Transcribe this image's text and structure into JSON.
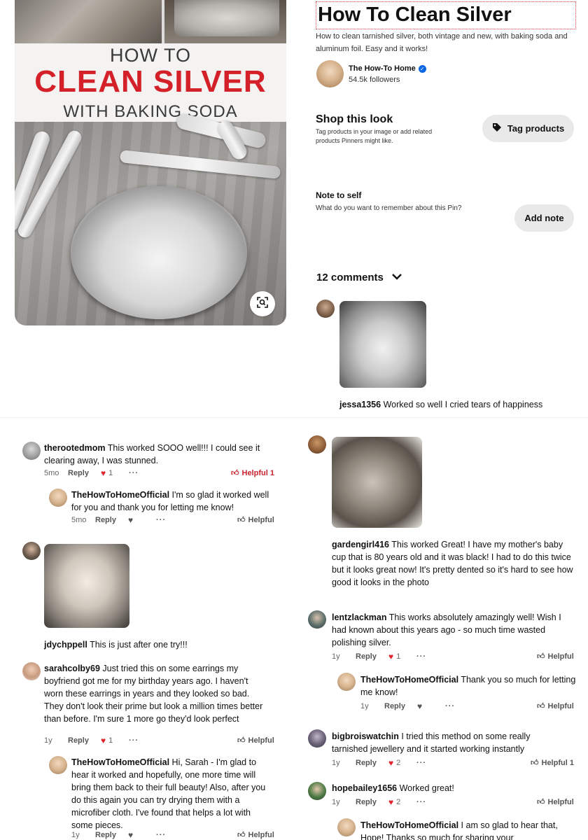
{
  "pin": {
    "image_title_line1": "HOW TO",
    "image_title_line2": "CLEAN SILVER",
    "image_title_line3": "WITH BAKING SODA",
    "title": "How To Clean Silver",
    "description": "How to clean tarnished silver, both vintage and new, with baking soda and aluminum foil. Easy and it works!",
    "lens_icon": "visual-search-icon"
  },
  "creator": {
    "name": "The How-To Home",
    "verified_mark": "✓",
    "followers": "54.5k followers"
  },
  "shop": {
    "title": "Shop this look",
    "subtitle": "Tag products in your image or add related products Pinners might like.",
    "button_label": "Tag products"
  },
  "note": {
    "title": "Note to self",
    "subtitle": "What do you want to remember about this Pin?",
    "button_label": "Add note"
  },
  "comments_header": {
    "label": "12 comments",
    "chevron": "⌄"
  },
  "colors": {
    "accent_red": "#e60023",
    "title_red": "#d42028",
    "verified_blue": "#0a66e4",
    "button_grey": "#e9e9e9"
  },
  "comments": {
    "jessa": {
      "user": "jessa1356",
      "text": "Worked so well I cried tears of happiness"
    },
    "rooted": {
      "user": "therootedmom",
      "text": "This worked SOOO well!!! I could see it clearing away, I was stunned.",
      "time": "5mo",
      "reply": "Reply",
      "likes": "1",
      "more": "···",
      "helpful": "Helpful 1"
    },
    "rooted_reply": {
      "user": "TheHowToHomeOfficial",
      "text": "I'm so glad it worked well for you and thank you for letting me know!",
      "time": "5mo",
      "reply": "Reply",
      "more": "···",
      "helpful": "Helpful"
    },
    "jdy": {
      "user": "jdychppell",
      "text": "This is just after one try!!!"
    },
    "sarah": {
      "user": "sarahcolby69",
      "text": "Just tried this on some earrings my boyfriend got me for my birthday years ago. I haven't worn these earrings in years and they looked so bad. They don't look their prime but look a million times better than before. I'm sure 1 more go they'd look perfect",
      "time": "1y",
      "reply": "Reply",
      "likes": "1",
      "more": "···",
      "helpful": "Helpful"
    },
    "sarah_reply": {
      "user": "TheHowToHomeOfficial",
      "text": "Hi, Sarah - I'm glad to hear it worked and hopefully, one more time will bring them back to their full beauty! Also, after you do this again you can try drying them with a microfiber cloth. I've found that helps a lot with some pieces.",
      "time": "1y",
      "reply": "Reply",
      "more": "···",
      "helpful": "Helpful"
    },
    "garden": {
      "user": "gardengirl416",
      "text": "This worked Great! I have my mother's baby cup that is 80 years old and it was black! I had to do this twice but it looks great now! It's pretty dented so it's hard to see how good it looks in the photo"
    },
    "lentz": {
      "user": "lentzlackman",
      "text": "This works absolutely amazingly well! Wish I had known about this years ago - so much time wasted polishing silver.",
      "time": "1y",
      "reply": "Reply",
      "likes": "1",
      "more": "···",
      "helpful": "Helpful"
    },
    "lentz_reply": {
      "user": "TheHowToHomeOfficial",
      "text": "Thank you so much for letting me know!",
      "time": "1y",
      "reply": "Reply",
      "more": "···",
      "helpful": "Helpful"
    },
    "bigbrois": {
      "user": "bigbroiswatchin",
      "text": "I tried this method on some really tarnished jewellery and it started working instantly",
      "time": "1y",
      "reply": "Reply",
      "likes": "2",
      "more": "···",
      "helpful": "Helpful 1"
    },
    "hope": {
      "user": "hopebailey1656",
      "text": "Worked great!",
      "time": "1y",
      "reply": "Reply",
      "likes": "2",
      "more": "···",
      "helpful": "Helpful"
    },
    "hope_reply": {
      "user": "TheHowToHomeOfficial",
      "text": "I am so glad to hear that, Hope! Thanks so much for sharing your"
    }
  }
}
